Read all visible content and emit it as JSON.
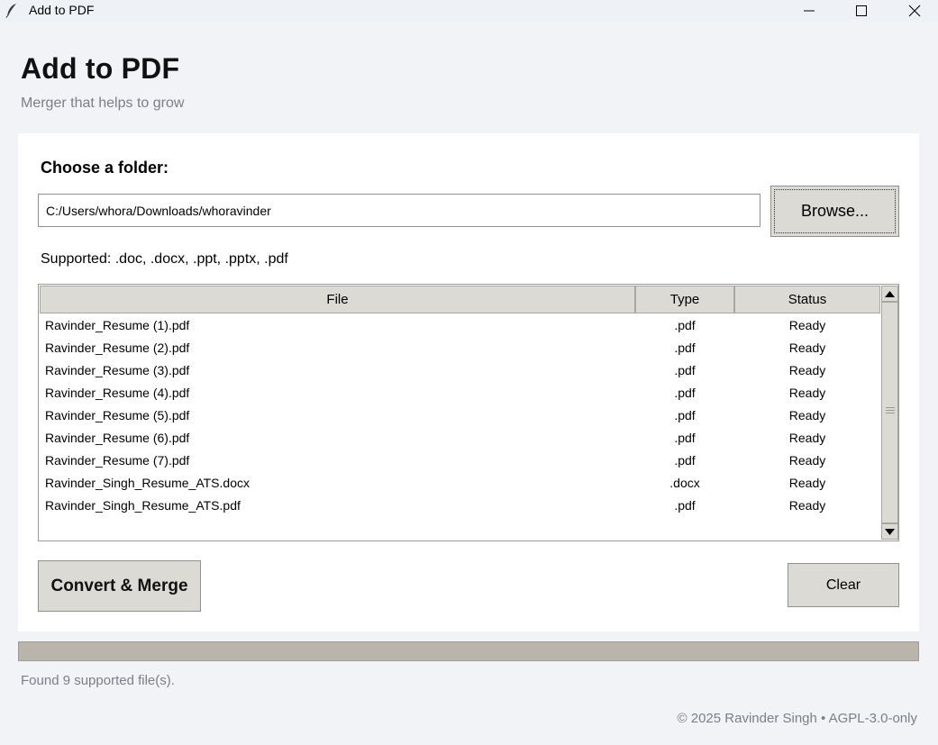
{
  "window": {
    "title": "Add to PDF",
    "icon": "feather-icon"
  },
  "header": {
    "title": "Add to PDF",
    "subtitle": "Merger that helps to grow"
  },
  "folder": {
    "label": "Choose a folder:",
    "path": "C:/Users/whora/Downloads/whoravinder",
    "browse_label": "Browse..."
  },
  "supported_text": "Supported: .doc, .docx, .ppt, .pptx, .pdf",
  "table": {
    "columns": [
      "File",
      "Type",
      "Status"
    ],
    "rows": [
      {
        "file": "Ravinder_Resume (1).pdf",
        "type": ".pdf",
        "status": "Ready"
      },
      {
        "file": "Ravinder_Resume (2).pdf",
        "type": ".pdf",
        "status": "Ready"
      },
      {
        "file": "Ravinder_Resume (3).pdf",
        "type": ".pdf",
        "status": "Ready"
      },
      {
        "file": "Ravinder_Resume (4).pdf",
        "type": ".pdf",
        "status": "Ready"
      },
      {
        "file": "Ravinder_Resume (5).pdf",
        "type": ".pdf",
        "status": "Ready"
      },
      {
        "file": "Ravinder_Resume (6).pdf",
        "type": ".pdf",
        "status": "Ready"
      },
      {
        "file": "Ravinder_Resume (7).pdf",
        "type": ".pdf",
        "status": "Ready"
      },
      {
        "file": "Ravinder_Singh_Resume_ATS.docx",
        "type": ".docx",
        "status": "Ready"
      },
      {
        "file": "Ravinder_Singh_Resume_ATS.pdf",
        "type": ".pdf",
        "status": "Ready"
      }
    ]
  },
  "actions": {
    "convert_label": "Convert & Merge",
    "clear_label": "Clear"
  },
  "progress": {
    "fraction": 0
  },
  "status": "Found 9 supported file(s).",
  "footer": "© 2025 Ravinder Singh • AGPL-3.0-only",
  "colors": {
    "background": "#f1f3f7",
    "card": "#ffffff",
    "button": "#dcdad5",
    "progress_trough": "#b9b4ac",
    "muted_text": "#7b7f86"
  }
}
